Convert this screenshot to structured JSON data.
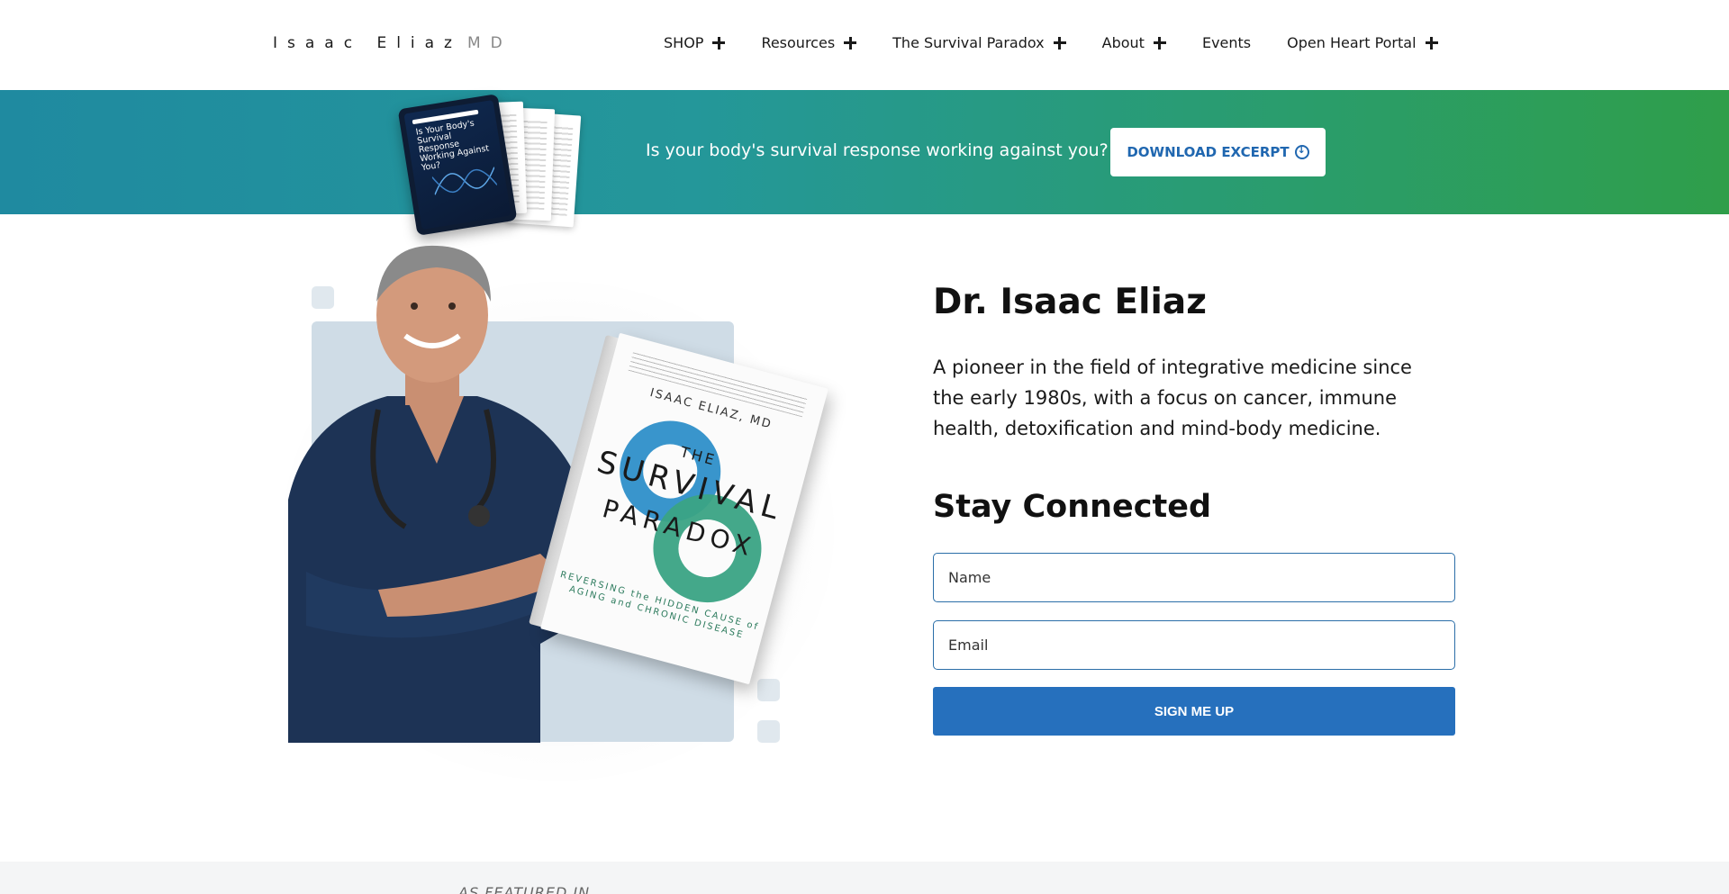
{
  "header": {
    "logo_name": "Isaac Eliaz",
    "logo_suffix": "MD",
    "nav": [
      {
        "label": "SHOP",
        "has_submenu": true
      },
      {
        "label": "Resources",
        "has_submenu": true
      },
      {
        "label": "The Survival Paradox",
        "has_submenu": true
      },
      {
        "label": "About",
        "has_submenu": true
      },
      {
        "label": "Events",
        "has_submenu": false
      },
      {
        "label": "Open Heart Portal",
        "has_submenu": true
      }
    ]
  },
  "banner": {
    "tablet_title": "Is Your Body's Survival Response Working Against You?",
    "text": "Is your body's survival response working against you?",
    "button_label": "DOWNLOAD EXCERPT",
    "button_icon": "download-circle-icon",
    "gradient_start": "#1f8aa0",
    "gradient_end": "#2f9e4a"
  },
  "book": {
    "author": "ISAAC ELIAZ, MD",
    "title_line1": "THE",
    "title_line2": "SURVIVAL",
    "title_line3": "PARADOX",
    "subtitle": "REVERSING the HIDDEN CAUSE of AGING and CHRONIC DISEASE"
  },
  "profile": {
    "name": "Dr. Isaac Eliaz",
    "bio": "A pioneer in the field of integrative medicine since the early 1980s, with a focus on cancer, immune health, detoxification and mind-body medicine."
  },
  "signup": {
    "heading": "Stay Connected",
    "name_placeholder": "Name",
    "email_placeholder": "Email",
    "button_label": "SIGN ME UP",
    "button_color": "#2670bd"
  },
  "featured": {
    "label": "AS FEATURED IN"
  }
}
